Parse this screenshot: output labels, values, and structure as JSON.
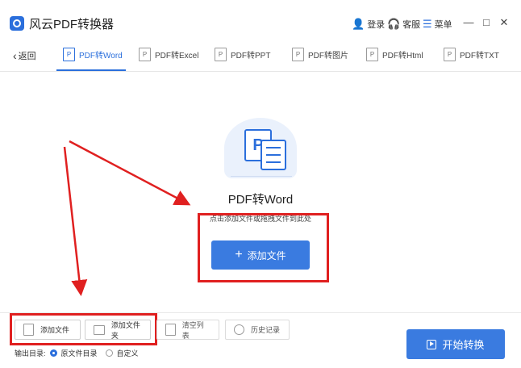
{
  "app": {
    "title": "风云PDF转换器"
  },
  "titlebar": {
    "login_label": "登录",
    "service_label": "客服",
    "menu_label": "菜单",
    "minimize_glyph": "—",
    "maximize_glyph": "□",
    "close_glyph": "✕"
  },
  "nav": {
    "back_label": "返回",
    "tabs": [
      {
        "label": "PDF转Word",
        "active": true
      },
      {
        "label": "PDF转Excel",
        "active": false
      },
      {
        "label": "PDF转PPT",
        "active": false
      },
      {
        "label": "PDF转图片",
        "active": false
      },
      {
        "label": "PDF转Html",
        "active": false
      },
      {
        "label": "PDF转TXT",
        "active": false
      }
    ]
  },
  "main": {
    "title": "PDF转Word",
    "hint": "点击添加文件或拖拽文件到此处",
    "add_button_label": "添加文件",
    "add_button_icon": "+"
  },
  "toolbar": {
    "add_file_label": "添加文件",
    "add_folder_label": "添加文件夹",
    "clear_list_label": "清空列表",
    "history_label": "历史记录"
  },
  "output": {
    "label": "输出目录:",
    "options": [
      {
        "label": "原文件目录",
        "selected": true
      },
      {
        "label": "自定义",
        "selected": false
      }
    ]
  },
  "start_button_label": "开始转换",
  "colors": {
    "accent": "#3a7be0",
    "annotation": "#e02020"
  }
}
